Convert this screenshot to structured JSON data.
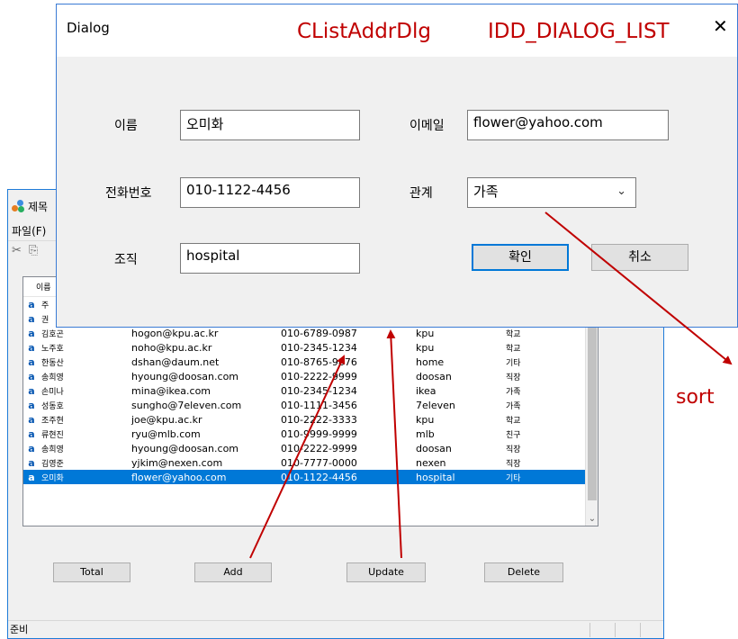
{
  "main_window": {
    "title": "제목",
    "menu": "파일(F)",
    "toolbar_icons": [
      "cut-icon",
      "copy-icon"
    ],
    "list_header": "이름",
    "list_rows": [
      {
        "icon": "a",
        "name": "주",
        "email": "",
        "phone": "",
        "org": "",
        "rel": ""
      },
      {
        "icon": "a",
        "name": "권",
        "email": "",
        "phone": "",
        "org": "",
        "rel": ""
      },
      {
        "icon": "a",
        "name": "김호곤",
        "email": "hogon@kpu.ac.kr",
        "phone": "010-6789-0987",
        "org": "kpu",
        "rel": "학교"
      },
      {
        "icon": "a",
        "name": "노주호",
        "email": "noho@kpu.ac.kr",
        "phone": "010-2345-1234",
        "org": "kpu",
        "rel": "학교"
      },
      {
        "icon": "a",
        "name": "한동산",
        "email": "dshan@daum.net",
        "phone": "010-8765-9876",
        "org": "home",
        "rel": "기타"
      },
      {
        "icon": "a",
        "name": "송희영",
        "email": "hyoung@doosan.com",
        "phone": "010-2222-9999",
        "org": "doosan",
        "rel": "직장"
      },
      {
        "icon": "a",
        "name": "손미나",
        "email": "mina@ikea.com",
        "phone": "010-2345-1234",
        "org": "ikea",
        "rel": "가족"
      },
      {
        "icon": "a",
        "name": "성동호",
        "email": "sungho@7eleven.com",
        "phone": "010-1111-3456",
        "org": "7eleven",
        "rel": "가족"
      },
      {
        "icon": "a",
        "name": "조주현",
        "email": "joe@kpu.ac.kr",
        "phone": "010-2222-3333",
        "org": "kpu",
        "rel": "학교"
      },
      {
        "icon": "a",
        "name": "류현진",
        "email": "ryu@mlb.com",
        "phone": "010-9999-9999",
        "org": "mlb",
        "rel": "친구"
      },
      {
        "icon": "a",
        "name": "송희영",
        "email": "hyoung@doosan.com",
        "phone": "010-2222-9999",
        "org": "doosan",
        "rel": "직장"
      },
      {
        "icon": "a",
        "name": "김영준",
        "email": "yjkim@nexen.com",
        "phone": "010-7777-0000",
        "org": "nexen",
        "rel": "직장"
      },
      {
        "icon": "a",
        "name": "오미화",
        "email": "flower@yahoo.com",
        "phone": "010-1122-4456",
        "org": "hospital",
        "rel": "기타",
        "selected": true
      }
    ],
    "buttons": {
      "total": "Total",
      "add": "Add",
      "update": "Update",
      "delete": "Delete"
    },
    "status": "준비"
  },
  "dialog": {
    "title": "Dialog",
    "labels": {
      "name": "이름",
      "email": "이메일",
      "phone": "전화번호",
      "relation": "관계",
      "org": "조직"
    },
    "values": {
      "name": "오미화",
      "email": "flower@yahoo.com",
      "phone": "010-1122-4456",
      "relation": "가족",
      "org": "hospital"
    },
    "ok": "확인",
    "cancel": "취소",
    "close_glyph": "✕"
  },
  "annotations": {
    "class_name": "CListAddrDlg",
    "dialog_id": "IDD_DIALOG_LIST",
    "sort": "sort",
    "color": "#c00000"
  }
}
